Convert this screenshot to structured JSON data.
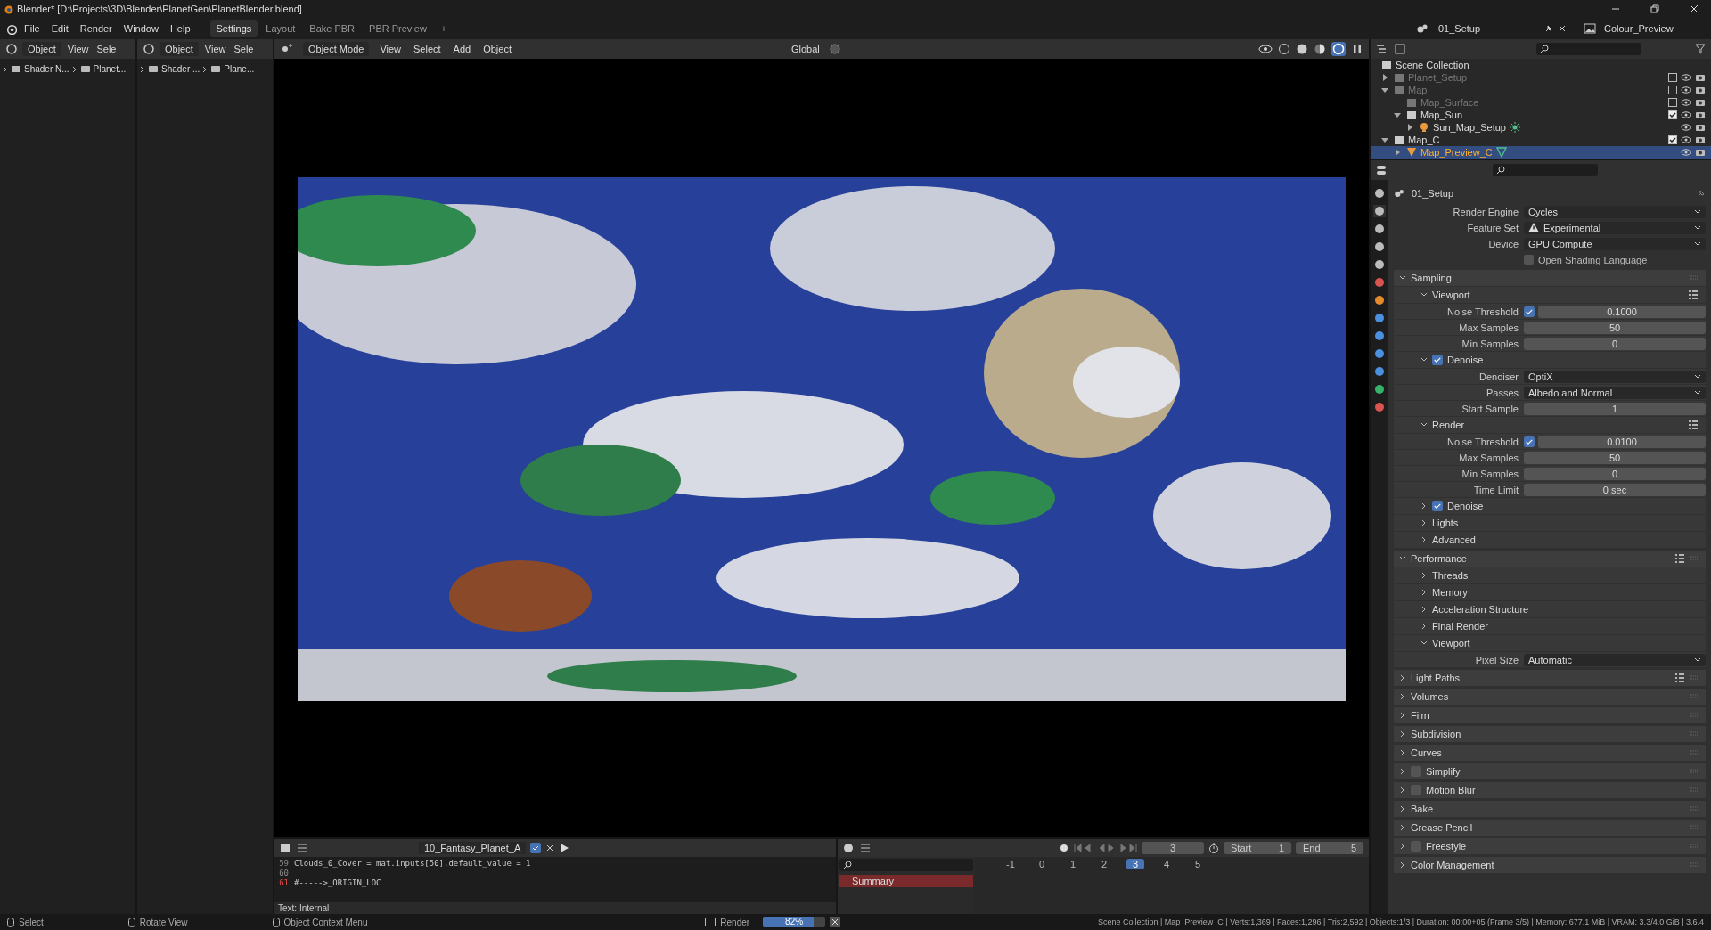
{
  "window": {
    "title": "Blender* [D:\\Projects\\3D\\Blender\\PlanetGen\\PlanetBlender.blend]"
  },
  "menu": [
    "File",
    "Edit",
    "Render",
    "Window",
    "Help"
  ],
  "workspaces": [
    {
      "label": "Settings",
      "selected": true
    },
    {
      "label": "Layout",
      "selected": false
    },
    {
      "label": "Bake PBR",
      "selected": false
    },
    {
      "label": "PBR Preview",
      "selected": false
    }
  ],
  "workspace_add": "+",
  "scene": "01_Setup",
  "view_layer": "Colour_Preview",
  "node_editors": [
    {
      "mode": "Object",
      "menus": [
        "View",
        "Sele"
      ],
      "breadcrumbs": [
        "Shader N...",
        "Planet..."
      ]
    },
    {
      "mode": "Object",
      "menus": [
        "View",
        "Sele"
      ],
      "breadcrumbs": [
        "Shader ...",
        "Plane..."
      ]
    }
  ],
  "viewport": {
    "mode": "Object Mode",
    "menus": [
      "View",
      "Select",
      "Add",
      "Object"
    ],
    "orientation": "Global"
  },
  "outliner": {
    "root": "Scene Collection",
    "items": [
      {
        "name": "Planet_Setup",
        "kind": "collection",
        "checked": false,
        "expanded": false,
        "selected": false
      },
      {
        "name": "Map",
        "kind": "collection",
        "checked": false,
        "expanded": true,
        "selected": false,
        "children": [
          {
            "name": "Map_Surface",
            "kind": "collection",
            "checked": false,
            "selected": false
          },
          {
            "name": "Map_Sun",
            "kind": "collection",
            "checked": true,
            "expanded": true,
            "selected": false,
            "children": [
              {
                "name": "Sun_Map_Setup",
                "kind": "light",
                "expanded": false,
                "selected": false
              }
            ]
          }
        ]
      },
      {
        "name": "Map_C",
        "kind": "collection",
        "checked": true,
        "expanded": true,
        "selected": false,
        "children": [
          {
            "name": "Map_Preview_C",
            "kind": "mesh",
            "expanded": false,
            "selected": true
          }
        ]
      }
    ]
  },
  "properties": {
    "header": "01_Setup",
    "rows": [
      {
        "kind": "dropdown",
        "label": "Render Engine",
        "value": "Cycles"
      },
      {
        "kind": "dropdown",
        "label": "Feature Set",
        "value": "Experimental",
        "warning": true
      },
      {
        "kind": "dropdown",
        "label": "Device",
        "value": "GPU Compute"
      },
      {
        "kind": "checkbox",
        "label": "Open Shading Language",
        "checked": false
      }
    ],
    "panels": [
      {
        "title": "Sampling",
        "expanded": true,
        "children": [
          {
            "title": "Viewport",
            "expanded": true,
            "presets": true,
            "rows": [
              {
                "kind": "number",
                "label": "Noise Threshold",
                "checked": true,
                "value": "0.1000"
              },
              {
                "kind": "number",
                "label": "Max Samples",
                "value": "50"
              },
              {
                "kind": "number",
                "label": "Min Samples",
                "value": "0"
              }
            ]
          },
          {
            "title": "Denoise",
            "expanded": true,
            "checked": true,
            "rows": [
              {
                "kind": "dropdown",
                "label": "Denoiser",
                "value": "OptiX"
              },
              {
                "kind": "dropdown",
                "label": "Passes",
                "value": "Albedo and Normal"
              },
              {
                "kind": "number",
                "label": "Start Sample",
                "value": "1"
              }
            ]
          },
          {
            "title": "Render",
            "expanded": true,
            "presets": true,
            "rows": [
              {
                "kind": "number",
                "label": "Noise Threshold",
                "checked": true,
                "value": "0.0100"
              },
              {
                "kind": "number",
                "label": "Max Samples",
                "value": "50"
              },
              {
                "kind": "number",
                "label": "Min Samples",
                "value": "0"
              },
              {
                "kind": "number",
                "label": "Time Limit",
                "value": "0 sec"
              }
            ]
          },
          {
            "title": "Denoise",
            "expanded": false,
            "checked": true
          },
          {
            "title": "Lights",
            "expanded": false
          },
          {
            "title": "Advanced",
            "expanded": false
          }
        ]
      },
      {
        "title": "Performance",
        "expanded": true,
        "presets": true,
        "children": [
          {
            "title": "Threads",
            "expanded": false
          },
          {
            "title": "Memory",
            "expanded": false
          },
          {
            "title": "Acceleration Structure",
            "expanded": false
          },
          {
            "title": "Final Render",
            "expanded": false
          },
          {
            "title": "Viewport",
            "expanded": true,
            "rows": [
              {
                "kind": "dropdown",
                "label": "Pixel Size",
                "value": "Automatic"
              }
            ]
          }
        ]
      },
      {
        "title": "Light Paths",
        "expanded": false,
        "presets": true
      },
      {
        "title": "Volumes",
        "expanded": false
      },
      {
        "title": "Film",
        "expanded": false
      },
      {
        "title": "Subdivision",
        "expanded": false
      },
      {
        "title": "Curves",
        "expanded": false
      },
      {
        "title": "Simplify",
        "expanded": false,
        "checked": false
      },
      {
        "title": "Motion Blur",
        "expanded": false,
        "checked": false
      },
      {
        "title": "Bake",
        "expanded": false
      },
      {
        "title": "Grease Pencil",
        "expanded": false
      },
      {
        "title": "Freestyle",
        "expanded": false,
        "checked": false
      },
      {
        "title": "Color Management",
        "expanded": false
      }
    ]
  },
  "text_editor": {
    "file": "10_Fantasy_Planet_A",
    "lines": [
      {
        "number": "59",
        "text": "Clouds_0_Cover = mat.inputs[50].default_value = 1",
        "current": false
      },
      {
        "number": "60",
        "current": false
      },
      {
        "number": "61",
        "text": "#----->_ORIGIN_LOC",
        "current": true
      }
    ],
    "footer": "Text: Internal"
  },
  "timeline": {
    "current_frame": "3",
    "start_label": "Start",
    "start": "1",
    "end_label": "End",
    "end": "5",
    "frames": [
      {
        "label": "-1",
        "selected": false
      },
      {
        "label": "0",
        "selected": false
      },
      {
        "label": "1",
        "selected": false
      },
      {
        "label": "2",
        "selected": false
      },
      {
        "label": "3",
        "selected": true
      },
      {
        "label": "4",
        "selected": false
      },
      {
        "label": "5",
        "selected": false
      }
    ],
    "channels": [
      "Summary"
    ]
  },
  "status_bar": {
    "hints": [
      "Select",
      "Rotate View",
      "Object Context Menu"
    ],
    "render": {
      "label": "Render",
      "level": 0.82,
      "reading": "82%"
    },
    "stats": "Scene Collection | Map_Preview_C | Verts:1,369 | Faces:1,296 | Tris:2,592 | Objects:1/3 | Duration: 00:00+05 (Frame 3/5) | Memory: 677.1 MiB | VRAM: 3.3/4.0 GiB | 3.6.4"
  }
}
